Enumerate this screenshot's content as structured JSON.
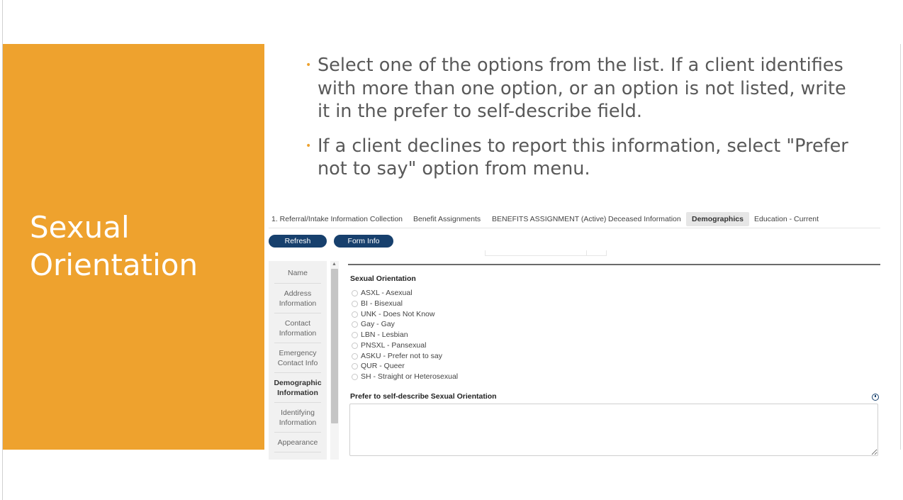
{
  "slide": {
    "title_lines": [
      "Sexual",
      "Orientation"
    ],
    "accent_color": "#EEA22E",
    "bullets": [
      "Select one of the options from the list. If a client identifies with more than one option, or an option is not listed, write it in the prefer to self-describe field.",
      "If a client declines to report this information, select \"Prefer not to say\" option from menu."
    ]
  },
  "app": {
    "tabs": [
      {
        "label": "1. Referral/Intake Information Collection",
        "active": false
      },
      {
        "label": "Benefit Assignments",
        "active": false
      },
      {
        "label": "BENEFITS ASSIGNMENT (Active)",
        "active": false
      },
      {
        "label": "Deceased Information",
        "active": false
      },
      {
        "label": "Demographics",
        "active": true
      },
      {
        "label": "Education - Current",
        "active": false
      }
    ],
    "buttons": {
      "refresh": "Refresh",
      "form_info": "Form Info"
    },
    "button_color": "#17406D",
    "sidenav": [
      {
        "label": "Name",
        "active": false
      },
      {
        "label": "Address Information",
        "active": false
      },
      {
        "label": "Contact Information",
        "active": false
      },
      {
        "label": "Emergency Contact Info",
        "active": false
      },
      {
        "label": "Demographic Information",
        "active": true
      },
      {
        "label": "Identifying Information",
        "active": false
      },
      {
        "label": "Appearance",
        "active": false
      }
    ],
    "sexual_orientation": {
      "label": "Sexual Orientation",
      "options": [
        "ASXL - Asexual",
        "BI - Bisexual",
        "UNK - Does Not Know",
        "Gay - Gay",
        "LBN - Lesbian",
        "PNSXL - Pansexual",
        "ASKU - Prefer not to say",
        "QUR - Queer",
        "SH - Straight or Heterosexual"
      ],
      "selected": null
    },
    "self_describe": {
      "label": "Prefer to self-describe Sexual Orientation",
      "value": ""
    },
    "icons": [
      "help-icon",
      "scroll-up-arrow-icon",
      "bullet-dot-icon"
    ]
  }
}
